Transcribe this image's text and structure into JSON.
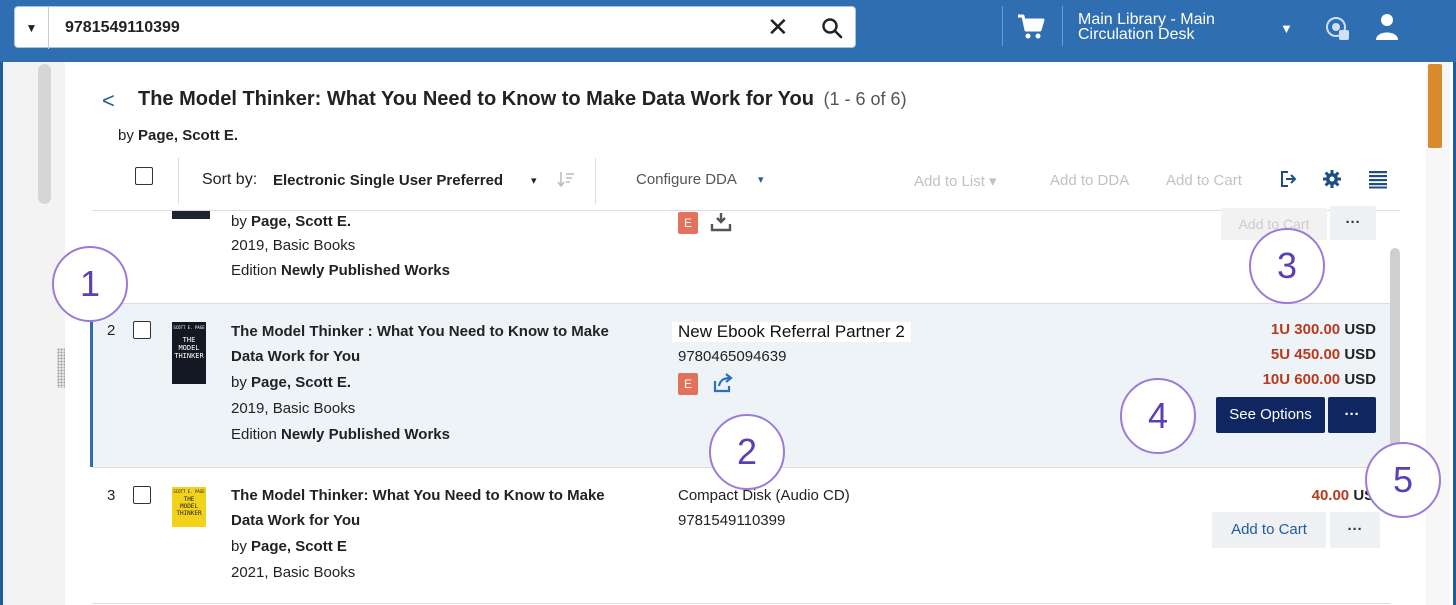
{
  "search": {
    "scope_arrow": "▼",
    "query": "9781549110399",
    "clear": "✕"
  },
  "header_bar": {
    "library": "Main Library - Main Circulation Desk",
    "library_arrow": "▼"
  },
  "results": {
    "back": "<",
    "title": "The Model Thinker: What You Need to Know to Make Data Work for You",
    "count": "(1 - 6 of 6)",
    "author_prefix": "by",
    "author": "Page, Scott E."
  },
  "toolbar": {
    "sort_label": "Sort by:",
    "sort_value": "Electronic Single User Preferred",
    "sort_arrow": "▾",
    "configure_dda": "Configure DDA",
    "configure_arrow": "▾",
    "add_to_list": "Add to List ▾",
    "add_to_dda": "Add to DDA",
    "add_to_cart": "Add to Cart"
  },
  "rows": [
    {
      "author_prefix": "by",
      "author": "Page, Scott E.",
      "year_pub": "2019, Basic Books",
      "edition_label": "Edition",
      "edition": "Newly Published Works",
      "badge": "E",
      "add_to_cart": "Add to Cart",
      "more": "···"
    },
    {
      "num": "2",
      "title_line1": "The Model Thinker : What You Need to Know to Make",
      "title_line2": "Data Work for You",
      "author_prefix": "by",
      "author": "Page, Scott E.",
      "year_pub": "2019, Basic Books",
      "edition_label": "Edition",
      "edition": "Newly Published Works",
      "vendor": "New Ebook Referral Partner 2",
      "isbn": "9780465094639",
      "badge": "E",
      "prices": [
        {
          "tier": "1U",
          "amount": "300.00",
          "currency": "USD"
        },
        {
          "tier": "5U",
          "amount": "450.00",
          "currency": "USD"
        },
        {
          "tier": "10U",
          "amount": "600.00",
          "currency": "USD"
        }
      ],
      "see_options": "See Options",
      "more": "···"
    },
    {
      "num": "3",
      "title_line1": "The Model Thinker: What You Need to Know to Make",
      "title_line2": "Data Work for You",
      "author_prefix": "by",
      "author": "Page, Scott E",
      "year_pub": "2021, Basic Books",
      "format": "Compact Disk (Audio CD)",
      "isbn": "9781549110399",
      "price": "40.00",
      "currency": "USD",
      "add_to_cart": "Add to Cart",
      "more": "···"
    }
  ],
  "covers": {
    "cover2": [
      "SCOTT E. PAGE",
      "THE",
      "MODEL",
      "THINKER"
    ],
    "cover3": [
      "SCOTT E. PAGE",
      "THE",
      "MODEL",
      "THINKER"
    ]
  },
  "annotations": [
    "1",
    "2",
    "3",
    "4",
    "5"
  ],
  "colors": {
    "topbar": "#2f6fb1",
    "price": "#b83a1e",
    "primary_button": "#0f2660",
    "annotation": "#9b7bd6",
    "badge": "#e2725b"
  }
}
